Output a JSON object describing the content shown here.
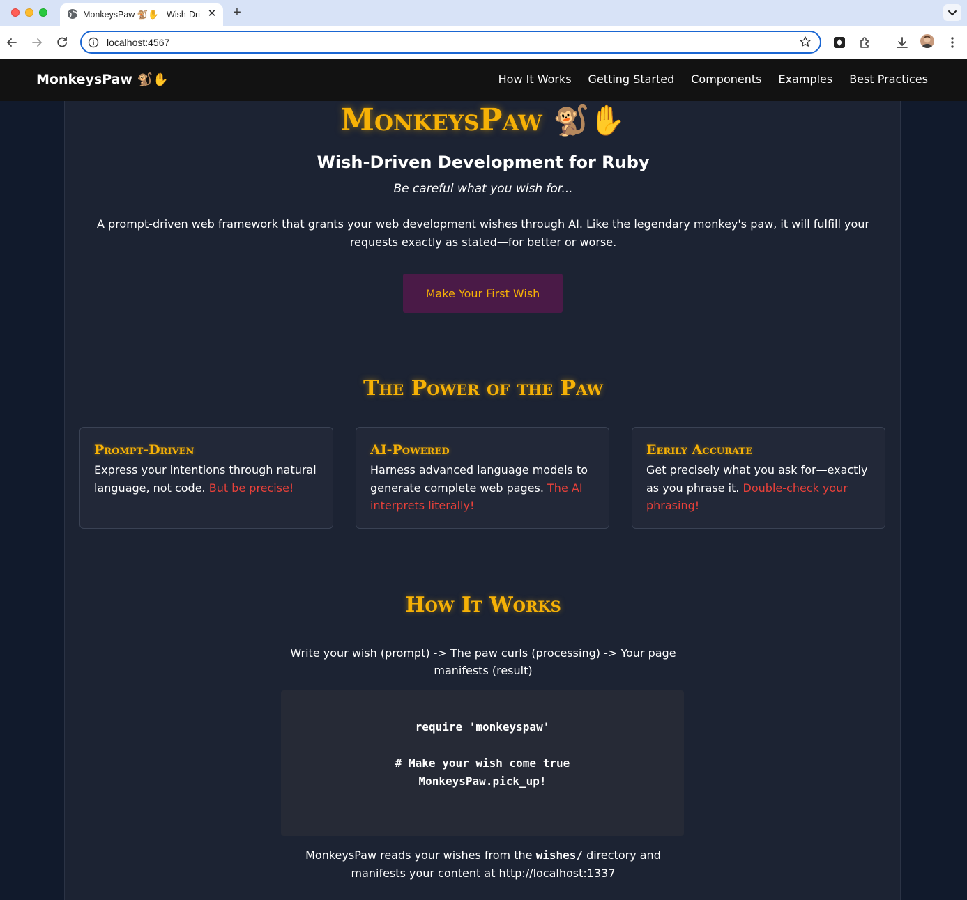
{
  "browser": {
    "tab_title": "MonkeysPaw 🐒✋ - Wish-Driven Development for Ruby",
    "new_tab_label": "+",
    "close_label": "✕",
    "url": "localhost:4567"
  },
  "site": {
    "brand": "MonkeysPaw",
    "brand_emoji": "🐒✋",
    "nav": [
      "How It Works",
      "Getting Started",
      "Components",
      "Examples",
      "Best Practices"
    ]
  },
  "hero": {
    "title": "MonkeysPaw",
    "title_emoji": "🐒✋",
    "subtitle": "Wish-Driven Development for Ruby",
    "tagline": "Be careful what you wish for...",
    "description": "A prompt-driven web framework that grants your web development wishes through AI. Like the legendary monkey's paw, it will fulfill your requests exactly as stated—for better or worse.",
    "cta_label": "Make Your First Wish"
  },
  "features": {
    "title": "The Power of the Paw",
    "cards": [
      {
        "title": "Prompt-Driven",
        "text": "Express your intentions through natural language, not code. ",
        "warning": "But be precise!"
      },
      {
        "title": "AI-Powered",
        "text": "Harness advanced language models to generate complete web pages. ",
        "warning": "The AI interprets literally!"
      },
      {
        "title": "Eerily Accurate",
        "text": "Get precisely what you ask for—exactly as you phrase it. ",
        "warning": "Double-check your phrasing!"
      }
    ]
  },
  "how_it_works": {
    "title": "How It Works",
    "flow": "Write your wish (prompt) -> The paw curls (processing) -> Your page manifests (result)",
    "code_lines": [
      "require 'monkeyspaw'",
      "",
      "# Make your wish come true",
      "MonkeysPaw.pick_up!"
    ],
    "footer_before": "MonkeysPaw reads your wishes from the ",
    "footer_code": "wishes/",
    "footer_after": " directory and manifests your content at http://localhost:1337"
  },
  "colors": {
    "accent": "#f6b106",
    "warning": "#e8413a",
    "cta_bg": "#4a1a47",
    "panel": "#1c2333",
    "navbar": "#121212"
  }
}
